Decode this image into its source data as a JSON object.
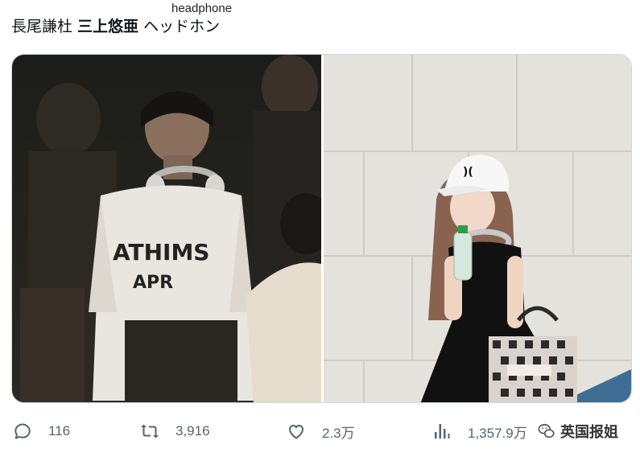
{
  "annotation": {
    "text": "headphone"
  },
  "tweet": {
    "text_before": "長尾謙杜 ",
    "text_bold": "三上悠亜",
    "text_after": " ヘッドホン"
  },
  "actions": {
    "reply_count": "116",
    "retweet_count": "3,916",
    "like_count": "2.3万",
    "view_count": "1,357.9万"
  },
  "watermark": {
    "text": "英国报姐"
  },
  "icons": [
    "reply-icon",
    "retweet-icon",
    "like-icon",
    "views-icon",
    "wechat-logo-icon"
  ]
}
